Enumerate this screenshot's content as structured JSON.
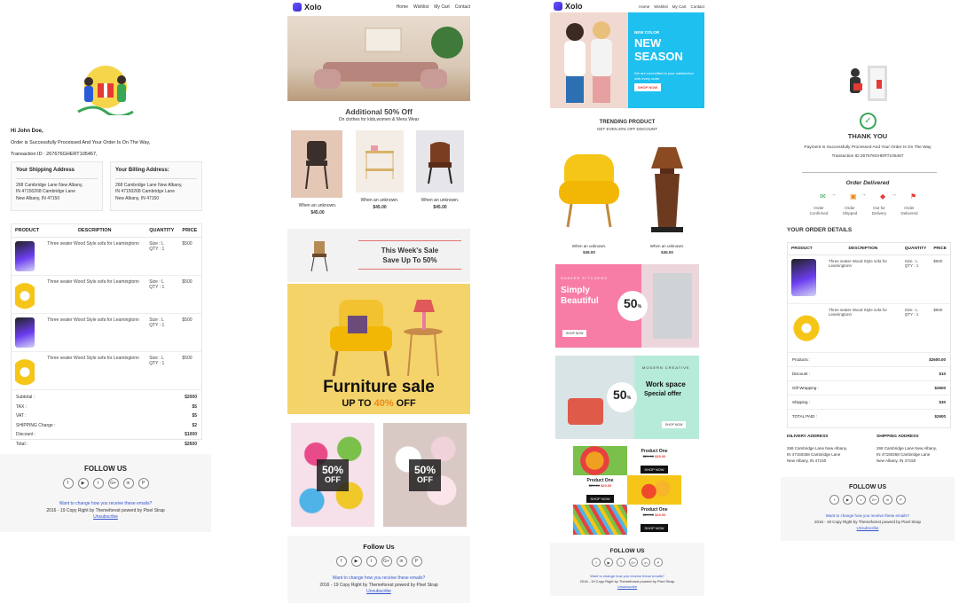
{
  "email1": {
    "greeting": "Hi John Doe,",
    "message": "Order is Successfully Processed And Your Order Is On The Way,",
    "transaction": "Transaction ID : 267676GHERT105467,",
    "shipping_title": "Your Shipping Address",
    "billing_title": "Your Billing Address:",
    "address_lines": [
      "268 Cambridge Lane New Albany,",
      "IN 47150268 Cambridge Lane",
      "New Albany, IN 47150"
    ],
    "table_headers": [
      "PRODUCT",
      "DESCRIPTION",
      "QUANTITY",
      "PRICE"
    ],
    "items": [
      {
        "desc": "Three seater Wood Style sofa for Leamingtonn",
        "size": "Size : L",
        "qty": "QTY : 1",
        "price": "$500",
        "icon": "phone"
      },
      {
        "desc": "Three seater Wood Style sofa for Leamingtonn",
        "size": "Size : L",
        "qty": "QTY : 1",
        "price": "$500",
        "icon": "headphones"
      },
      {
        "desc": "Three seater Wood Style sofa for Leamingtonn",
        "size": "Size : L",
        "qty": "QTY : 1",
        "price": "$500",
        "icon": "phone"
      },
      {
        "desc": "Three seater Wood Style sofa for Leamingtonn",
        "size": "Size : L",
        "qty": "QTY : 1",
        "price": "$500",
        "icon": "headphones"
      }
    ],
    "totals": [
      {
        "label": "Subtotal :",
        "value": "$2000"
      },
      {
        "label": "TAX :",
        "value": "$5"
      },
      {
        "label": "VAT :",
        "value": "$5"
      },
      {
        "label": "SHIPPING Charge :",
        "value": "$2"
      },
      {
        "label": "Discount :",
        "value": "$1000"
      },
      {
        "label": "Total :",
        "value": "$2600"
      }
    ],
    "follow": "FOLLOW US",
    "change_link": "Want to change how you receive these emails?",
    "copyright": "2016 - 19 Copy Right by Themeforest powerd by Pixel Strap",
    "unsubscribe": "Unsubscribe"
  },
  "email2": {
    "logo": "Xolo",
    "nav": [
      "Home",
      "Wishlist",
      "My Cart",
      "Contact"
    ],
    "offer_title": "Additional 50% Off",
    "offer_sub": "On clothes for kids,women & Mens Wear",
    "products": [
      {
        "caption": "When an unknown.",
        "price": "$45.00"
      },
      {
        "caption": "When an unknown.",
        "price": "$45.00"
      },
      {
        "caption": "When an unknown.",
        "price": "$45.00"
      }
    ],
    "week_line1": "This Week's Sale",
    "week_line2": "Save Up To 50%",
    "sale_title": "Furniture sale",
    "sale_sub_prefix": "UP TO ",
    "sale_sub_pct": "40%",
    "sale_sub_suffix": " OFF",
    "off1": [
      "50%",
      "OFF"
    ],
    "off2": [
      "50%",
      "OFF"
    ],
    "follow": "Follow Us",
    "change_link": "Want to change how you receive these emails?",
    "copyright": "2016 - 19 Copy Right by Themeforest powerd by Pixel Strap",
    "unsubscribe": "Unsubscribe"
  },
  "email3": {
    "logo": "Xolo",
    "nav": [
      "Home",
      "Wishlist",
      "My Cart",
      "Contact"
    ],
    "hero_tag": "NEW COLOR",
    "hero_line1": "NEW",
    "hero_line2": "SEASON",
    "hero_body": "We are committed to your satisfaction with every order",
    "hero_btn": "SHOP NOW",
    "trending_title": "TRENDING PRODUCT",
    "trending_sub": "GET EVEN 20% OFF DISCOUNT",
    "products": [
      {
        "caption": "When an unknown.",
        "price": "$45.00"
      },
      {
        "caption": "When an unknown.",
        "price": "$45.00"
      }
    ],
    "banner1_tag": "SHAKER KITCHENS",
    "banner1_line1": "Simply",
    "banner1_line2": "Beautiful",
    "banner1_pct": "50",
    "banner1_btn": "SHOP NOW",
    "banner2_tag": "MODERN CREATIVE",
    "banner2_line1": "Work space",
    "banner2_line2": "Special offer",
    "banner2_pct": "50",
    "banner2_btn": "SHOP NOW",
    "grid": [
      {
        "name": "Product One",
        "old": "$29.00",
        "new": "$29.00",
        "btn": "SHOP NOW"
      },
      {
        "name": "Product One",
        "old": "$29.00",
        "new": "$29.00",
        "btn": "SHOP NOW"
      },
      {
        "name": "Product One",
        "old": "$29.00",
        "new": "$29.00",
        "btn": "SHOP NOW"
      }
    ],
    "follow": "FOLLOW US",
    "change_link": "Want to change how you receive these emails?",
    "copyright": "2016 - 19 Copy Right by Themeforest powerd by Pixel Strap",
    "unsubscribe": "Unsubscribe"
  },
  "email4": {
    "thank_you": "THANK YOU",
    "message": "Payment Is Successfully Processed And Your Order Is On The Way",
    "transaction": "Transaction ID:267676GHERT105467",
    "delivered_title": "Order Delivered",
    "steps": [
      "Order Confirmed",
      "Order Shipped",
      "Out for Delivery",
      "Order Delivered"
    ],
    "details_title": "YOUR ORDER DETAILS",
    "table_headers": [
      "PRODUCT",
      "DESCRIPTION",
      "QUANTITY",
      "PRICE"
    ],
    "items": [
      {
        "desc": "Three seater Wood Style sofa for Leamingtonn",
        "size": "Size : L",
        "qty": "QTY : 1",
        "price": "$500",
        "icon": "phone"
      },
      {
        "desc": "Three seater Wood Style sofa for Leamingtonn",
        "size": "Size : L",
        "qty": "QTY : 1",
        "price": "$500",
        "icon": "headphones"
      }
    ],
    "totals": [
      {
        "label": "Products :",
        "value": "$2600.00"
      },
      {
        "label": "Discount :",
        "value": "$10"
      },
      {
        "label": "Gift Wrapping :",
        "value": "$2600"
      },
      {
        "label": "Shipping :",
        "value": "$30"
      },
      {
        "label": "TOTAL PAID :",
        "value": "$2600"
      }
    ],
    "delivery_title": "DILIVERY ADDRESS",
    "shipping_title": "SHIPPING ADDRESS",
    "address_lines": [
      "268 Cambridge Lane New Albany,",
      "IN 47150268 Cambridge Lane",
      "New Albany, IN 47150"
    ],
    "follow": "FOLLOW US",
    "change_link": "Want to change how you receive these emails?",
    "copyright": "2016 - 19 Copy Right by Themeforest powerd by Pixel Strap",
    "unsubscribe": "Unsubscribe"
  },
  "social_icons": [
    "f",
    "▶",
    "t",
    "G+",
    "in",
    "P"
  ],
  "colors": {
    "accent_red": "#e53935",
    "sale_yellow": "#f5d36b",
    "hero_cyan": "#1ec0f0",
    "logo_purple": "#5b44f2"
  }
}
